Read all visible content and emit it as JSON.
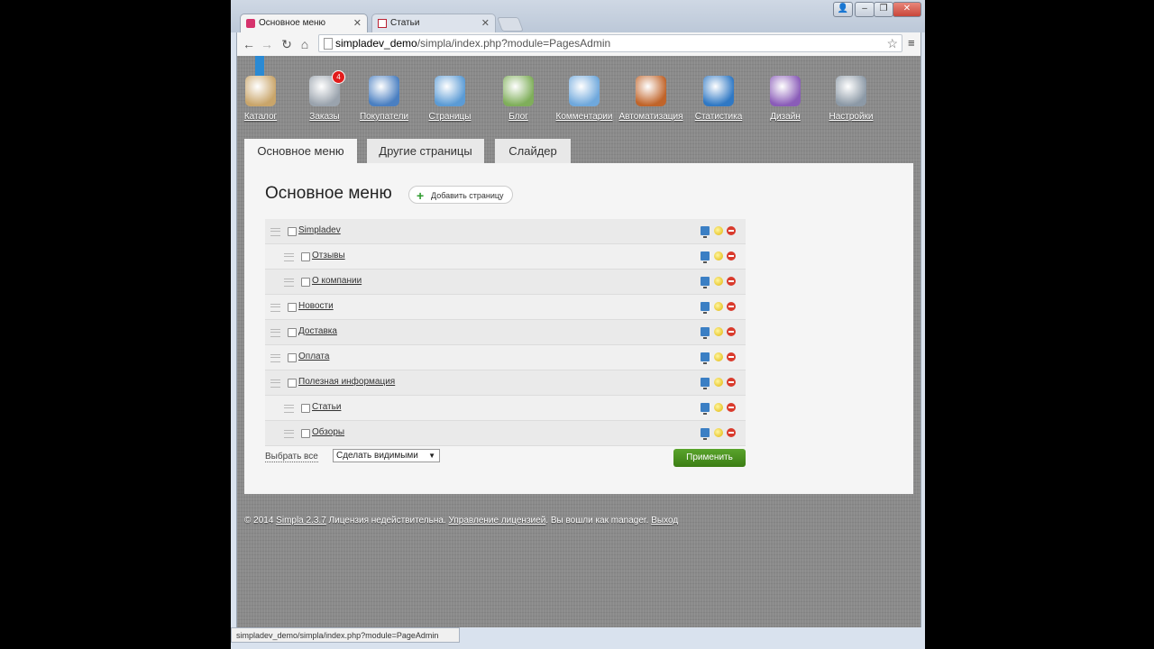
{
  "browser": {
    "tabs": [
      {
        "label": "Основное меню",
        "icon": "simpla-icon"
      },
      {
        "label": "Статьи",
        "icon": "page-icon"
      }
    ],
    "url_host": "simpladev_demo",
    "url_path": "/simpla/index.php?module=PagesAdmin",
    "status_url": "simpladev_demo/simpla/index.php?module=PageAdmin"
  },
  "nav": [
    {
      "label": "Каталог",
      "icon": "catalog-icon",
      "color": "#c9a56a"
    },
    {
      "label": "Заказы",
      "icon": "orders-icon",
      "color": "#9aa3ad",
      "badge": "4"
    },
    {
      "label": "Покупатели",
      "icon": "users-icon",
      "color": "#4a7fc1"
    },
    {
      "label": "Страницы",
      "icon": "pages-icon",
      "color": "#5b9bd5"
    },
    {
      "label": "Блог",
      "icon": "blog-icon",
      "color": "#7fae5a"
    },
    {
      "label": "Комментарии",
      "icon": "comments-icon",
      "color": "#6fa8dc"
    },
    {
      "label": "Автоматизация",
      "icon": "magic-wand-icon",
      "color": "#c0642a"
    },
    {
      "label": "Статистика",
      "icon": "stats-icon",
      "color": "#2f78c4"
    },
    {
      "label": "Дизайн",
      "icon": "design-icon",
      "color": "#8a5cb8"
    },
    {
      "label": "Настройки",
      "icon": "settings-icon",
      "color": "#8c99a6"
    }
  ],
  "subtabs": [
    "Основное меню",
    "Другие страницы",
    "Слайдер"
  ],
  "main": {
    "title": "Основное меню",
    "add_button": "Добавить страницу",
    "pages": [
      {
        "name": "Simpladev",
        "level": 0
      },
      {
        "name": "Отзывы",
        "level": 1
      },
      {
        "name": "О компании",
        "level": 1
      },
      {
        "name": "Новости",
        "level": 0
      },
      {
        "name": "Доставка",
        "level": 0
      },
      {
        "name": "Оплата",
        "level": 0
      },
      {
        "name": "Полезная информация",
        "level": 0
      },
      {
        "name": "Статьи",
        "level": 1
      },
      {
        "name": "Обзоры",
        "level": 1
      }
    ],
    "select_all": "Выбрать все",
    "bulk_action": "Сделать видимыми",
    "apply_button": "Применить"
  },
  "footer": {
    "copyright": "© 2014 ",
    "version_link": "Simpla 2.3.7",
    "license_text": " Лицензия недействительна. ",
    "license_link": "Управление лицензией",
    "logged_text": ". Вы вошли как manager. ",
    "logout_link": "Выход"
  },
  "colors": {
    "accent_green": "#3b7d14",
    "delete_red": "#d93a2c",
    "badge_red": "#e21c1c"
  }
}
